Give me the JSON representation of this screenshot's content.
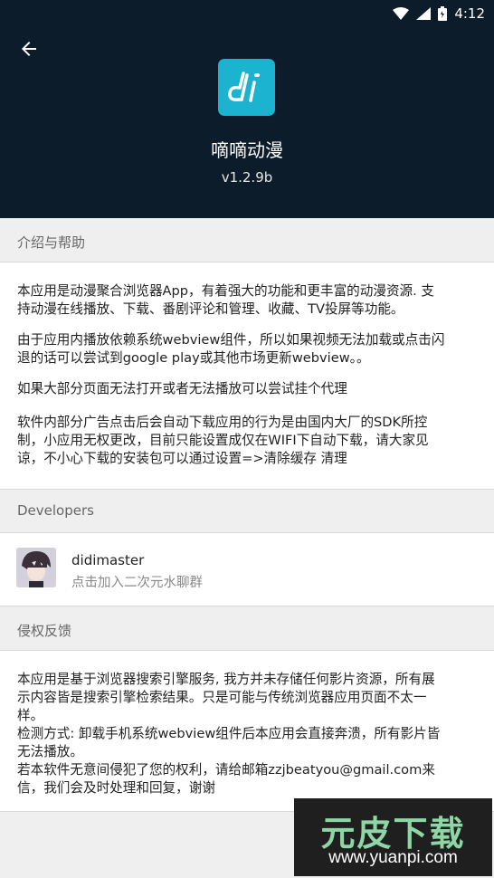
{
  "status_bar": {
    "time": "4:12",
    "icons": [
      "wifi-icon",
      "signal-icon",
      "battery-icon"
    ]
  },
  "header": {
    "back_icon": "arrow-left-icon",
    "app_name": "嘀嘀动漫",
    "version": "v1.2.9b",
    "logo_glyph": "di",
    "logo_color": "#1bb3cf",
    "background": "#0d1c2a"
  },
  "intro": {
    "title": "介绍与帮助",
    "paragraphs": [
      {
        "lines": [
          "本应用是动漫聚合浏览器App，有着强大的功能和更丰富的动漫资源. 支",
          "持动漫在线播放、下载、番剧评论和管理、收藏、TV投屏等功能。"
        ]
      },
      {
        "lines": [
          "由于应用内播放依赖系统webview组件，所以如果视频无法加载或点击闪",
          "退的话可以尝试到google play或其他市场更新webview。。"
        ]
      },
      {
        "lines": [
          "如果大部分页面无法打开或者无法播放可以尝试挂个代理"
        ]
      },
      {
        "lines": [
          "软件内部分广告点击后会自动下载应用的行为是由国内大厂的SDK所控",
          "制，小应用无权更改，目前只能设置成仅在WIFI下自动下载，请大家见",
          "谅，不小心下载的安装包可以通过设置=>清除缓存 清理"
        ]
      }
    ]
  },
  "developers": {
    "title": "Developers",
    "name": "didimaster",
    "subtitle": "点击加入二次元水聊群"
  },
  "copyright": {
    "title": "侵权反馈",
    "lines": [
      "本应用是基于浏览器搜索引擎服务, 我方并未存储任何影片资源，所有展",
      "示内容皆是搜索引擎检索结果。只是可能与传统浏览器应用页面不太一",
      "样。",
      "检测方式: 卸载手机系统webview组件后本应用会直接奔溃，所有影片皆",
      "无法播放。",
      "若本软件无意间侵犯了您的权利，请给邮箱zzjbeatyou@gmail.com来",
      "信，我们会及时处理和回复，谢谢"
    ]
  },
  "watermark": {
    "title": "元皮下载",
    "url": "www.yuanpi.com"
  }
}
